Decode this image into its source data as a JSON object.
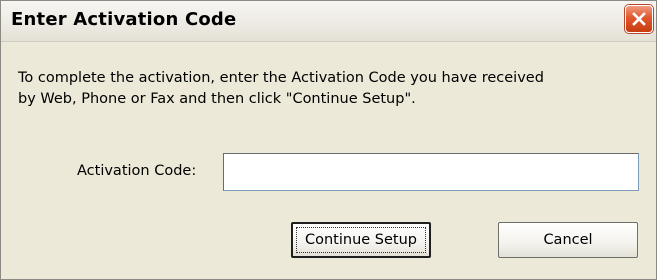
{
  "window": {
    "title": "Enter Activation Code"
  },
  "message": {
    "line1": "To complete the activation, enter the Activation Code you have received",
    "line2": "by Web, Phone or Fax and then click \"Continue Setup\"."
  },
  "form": {
    "label": "Activation Code:",
    "value": ""
  },
  "buttons": {
    "continue_label": "Continue Setup",
    "cancel_label": "Cancel"
  },
  "icons": {
    "close": "close-icon"
  },
  "colors": {
    "close_button": "#e1562d",
    "dialog_background": "#ece9d8"
  }
}
